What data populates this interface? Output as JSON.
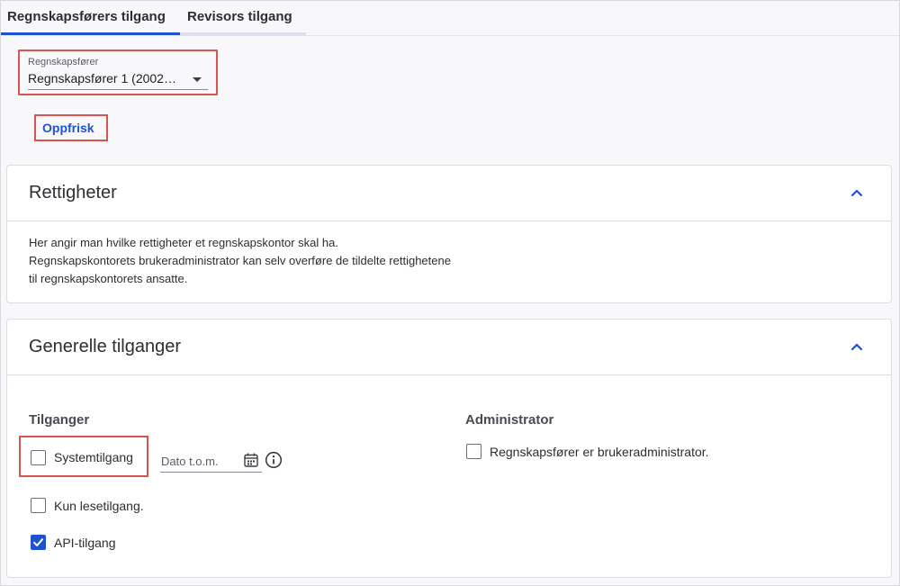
{
  "tabs": [
    {
      "label": "Regnskapsførers tilgang",
      "active": true
    },
    {
      "label": "Revisors tilgang",
      "active": false
    }
  ],
  "accountant_select": {
    "label": "Regnskapsfører",
    "value": "Regnskapsfører 1 (2002…"
  },
  "refresh_label": "Oppfrisk",
  "rights_panel": {
    "title": "Rettigheter",
    "description_lines": [
      "Her angir man hvilke rettigheter et regnskapskontor skal ha.",
      "Regnskapskontorets brukeradministrator kan selv overføre de tildelte rettighetene",
      "til regnskapskontorets ansatte."
    ]
  },
  "general_panel": {
    "title": "Generelle tilganger",
    "access_heading": "Tilganger",
    "admin_heading": "Administrator",
    "options": [
      {
        "label": "Systemtilgang",
        "checked": false
      },
      {
        "label": "Kun lesetilgang.",
        "checked": false
      },
      {
        "label": "API-tilgang",
        "checked": true
      }
    ],
    "admin_option": {
      "label": "Regnskapsfører er brukeradministrator.",
      "checked": false
    },
    "date_placeholder": "Dato t.o.m."
  },
  "colors": {
    "accent": "#1f52d1",
    "highlight": "#d9534f"
  },
  "icons": {
    "dropdown": "caret-down-icon",
    "collapse": "chevron-up-icon",
    "calendar": "calendar-icon",
    "info": "info-icon",
    "check": "checkmark-icon"
  }
}
